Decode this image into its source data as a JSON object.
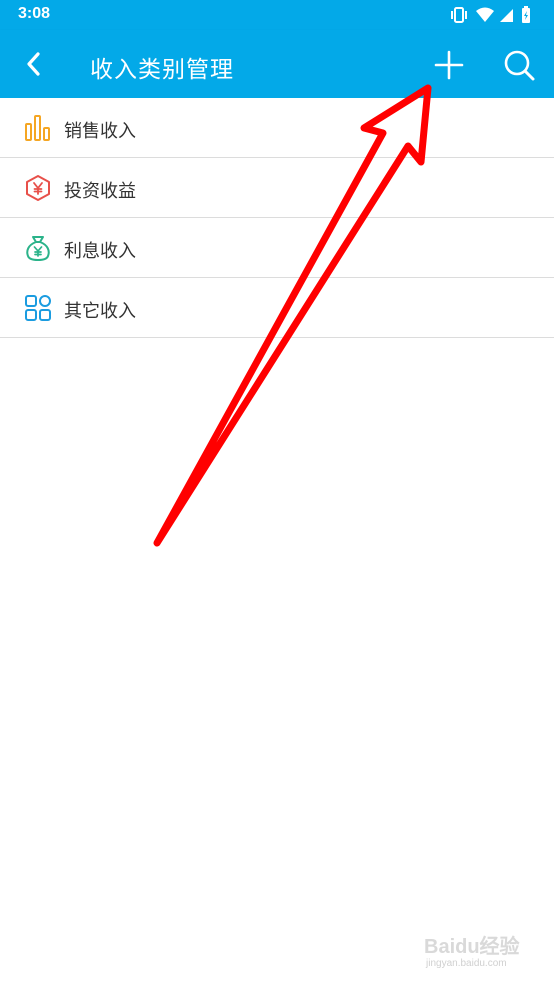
{
  "status_bar": {
    "time": "3:08",
    "icons": [
      "vibrate-icon",
      "wifi-icon",
      "signal-icon",
      "battery-charging-icon"
    ]
  },
  "app_bar": {
    "title": "收入类别管理",
    "back_icon": "chevron-left-icon",
    "add_icon": "plus-icon",
    "search_icon": "search-icon",
    "color": "#03a9e8"
  },
  "categories": [
    {
      "label": "销售收入",
      "icon": "bar-chart-icon",
      "color": "#f5a623"
    },
    {
      "label": "投资收益",
      "icon": "yen-hexagon-icon",
      "color": "#e8504a"
    },
    {
      "label": "利息收入",
      "icon": "money-bag-icon",
      "color": "#2bb38a"
    },
    {
      "label": "其它收入",
      "icon": "grid-apps-icon",
      "color": "#1b9ce0"
    }
  ],
  "annotation": {
    "type": "red-arrow",
    "color": "#ff0000",
    "points_to": "add-button"
  },
  "watermark": {
    "brand": "Baidu经验",
    "url": "jingyan.baidu.com"
  }
}
